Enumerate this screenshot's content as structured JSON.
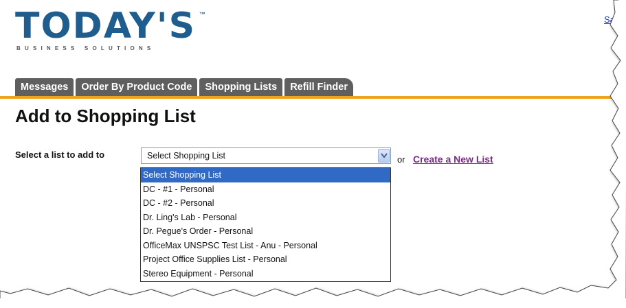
{
  "logo": {
    "word": "TODAY'S",
    "tm": "™",
    "tagline": "BUSINESS SOLUTIONS"
  },
  "header": {
    "save_link": "Sav"
  },
  "tabs": [
    {
      "label": "Messages"
    },
    {
      "label": "Order By Product Code"
    },
    {
      "label": "Shopping Lists"
    },
    {
      "label": "Refill Finder"
    }
  ],
  "main": {
    "title": "Add to Shopping List",
    "select_label": "Select a list to add to",
    "select_value": "Select Shopping List",
    "or_text": "or",
    "create_link": "Create a New List"
  },
  "dropdown": {
    "options": [
      "Select Shopping List",
      "DC - #1 - Personal",
      "DC - #2 - Personal",
      "Dr. Ling's Lab - Personal",
      "Dr. Pegue's Order - Personal",
      "OfficeMax UNSPSC Test List - Anu - Personal",
      "Project Office Supplies List - Personal",
      "Stereo Equipment - Personal"
    ],
    "selected_index": 0
  },
  "colors": {
    "logo_blue": "#1f5d8f",
    "tab_gray": "#5f5f5f",
    "accent_orange": "#f0a31e",
    "highlight_blue": "#316ac5",
    "link_purple": "#7a2a8a"
  }
}
